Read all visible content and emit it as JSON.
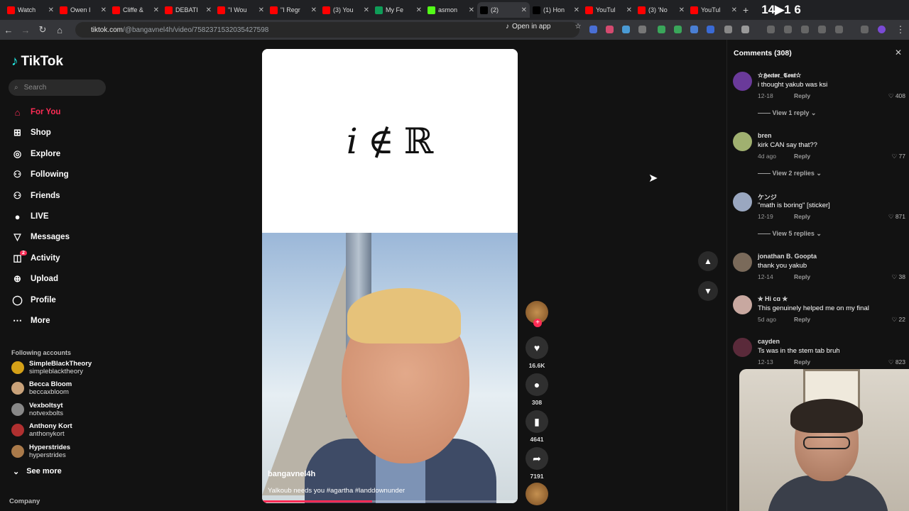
{
  "browser": {
    "tabs": [
      {
        "label": "Watch",
        "color": "#ff0000"
      },
      {
        "label": "Owen I",
        "color": "#ff0000"
      },
      {
        "label": "Cliffe &",
        "color": "#ff0000"
      },
      {
        "label": "DEBATI",
        "color": "#ff0000"
      },
      {
        "label": "\"I Wou",
        "color": "#ff0000"
      },
      {
        "label": "\"I Regr",
        "color": "#ff0000"
      },
      {
        "label": "(3) You",
        "color": "#ff0000"
      },
      {
        "label": "My Fe",
        "color": "#0f9d58"
      },
      {
        "label": "asmon",
        "color": "#53fc18"
      },
      {
        "label": "(2)",
        "color": "#000000"
      },
      {
        "label": "(1) Hon",
        "color": "#000000"
      },
      {
        "label": "YouTul",
        "color": "#ff0000"
      },
      {
        "label": "(3) 'No",
        "color": "#ff0000"
      },
      {
        "label": "YouTul",
        "color": "#ff0000"
      }
    ],
    "url_host": "tiktok.com",
    "url_path": "/@bangavnel4h/video/7582371532035427598",
    "open_in_app": "Open in app",
    "overlay_text": "14▶1 6"
  },
  "sidebar": {
    "logo": "TikTok",
    "search_placeholder": "Search",
    "nav": [
      {
        "label": "For You",
        "icon": "home-icon"
      },
      {
        "label": "Shop",
        "icon": "shop-icon"
      },
      {
        "label": "Explore",
        "icon": "compass-icon"
      },
      {
        "label": "Following",
        "icon": "following-icon"
      },
      {
        "label": "Friends",
        "icon": "friends-icon"
      },
      {
        "label": "LIVE",
        "icon": "live-icon"
      },
      {
        "label": "Messages",
        "icon": "messages-icon"
      },
      {
        "label": "Activity",
        "icon": "activity-icon",
        "badge": "2"
      },
      {
        "label": "Upload",
        "icon": "upload-icon"
      },
      {
        "label": "Profile",
        "icon": "profile-icon"
      },
      {
        "label": "More",
        "icon": "more-icon"
      }
    ],
    "following_title": "Following accounts",
    "accounts": [
      {
        "name": "SimpleBlackTheory",
        "handle": "simpleblacktheory",
        "color": "#d4a017"
      },
      {
        "name": "Becca Bloom",
        "handle": "beccaxbloom",
        "color": "#c9a27a"
      },
      {
        "name": "Vexboltsyt",
        "handle": "notvexbolts",
        "color": "#888888"
      },
      {
        "name": "Anthony Kort",
        "handle": "anthonykort",
        "color": "#b03030"
      },
      {
        "name": "Hyperstrides",
        "handle": "hyperstrides",
        "color": "#aa7a4a"
      }
    ],
    "see_more": "See more",
    "company": "Company"
  },
  "video": {
    "formula_i": "i",
    "formula_op": "∉",
    "formula_set": "ℝ",
    "username": "bangavnel4h",
    "caption": "Yalkoub needs you #agartha #landdownunder",
    "progress": 0.43
  },
  "actions": {
    "likes": "16.6K",
    "comments": "308",
    "saves": "4641",
    "shares": "7191"
  },
  "comments": {
    "title": "Comments (308)",
    "items": [
      {
        "name": "✫𝕳𝖊𝖈𝖙𝖔𝖗_𝕮𝖔𝖓𝖙✫",
        "text": "i thought yakub was ksi",
        "date": "12-18",
        "reply": "Reply",
        "likes": "408",
        "view": "View 1 reply",
        "color": "#6a3a9a"
      },
      {
        "name": "bren",
        "text": "kirk CAN say that??",
        "date": "4d ago",
        "reply": "Reply",
        "likes": "77",
        "view": "View 2 replies",
        "color": "#a0b070"
      },
      {
        "name": "ケンジ",
        "text": "\"math is boring\" [sticker]",
        "date": "12-19",
        "reply": "Reply",
        "likes": "871",
        "view": "View 5 replies",
        "color": "#9aa7c0"
      },
      {
        "name": "jonathan B. Goopta",
        "text": "thank you yakub",
        "date": "12-14",
        "reply": "Reply",
        "likes": "38",
        "view": "",
        "color": "#7a6a5a"
      },
      {
        "name": "✮ Hi cɑ ✮",
        "text": "This genuinely helped me on my final",
        "date": "5d ago",
        "reply": "Reply",
        "likes": "22",
        "view": "",
        "color": "#c8a8a0"
      },
      {
        "name": "cayden",
        "text": "Ts was in the stem tab bruh",
        "date": "12-13",
        "reply": "Reply",
        "likes": "823",
        "view": "",
        "color": "#5a2a3a"
      }
    ]
  }
}
